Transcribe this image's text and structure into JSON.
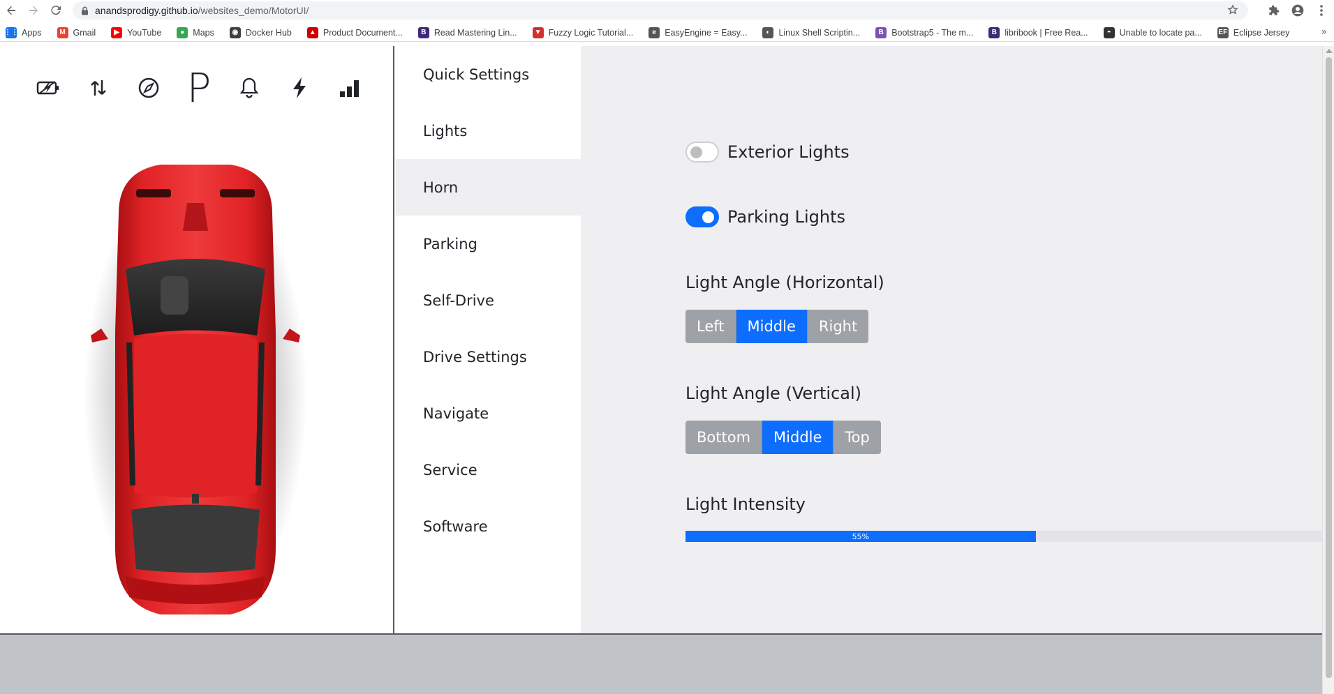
{
  "browser": {
    "url_host": "anandsprodigy.github.io",
    "url_path": "/websites_demo/MotorUI/",
    "bookmarks": [
      {
        "label": "Apps",
        "icon": "apps-grid-icon",
        "color": "#1a73e8"
      },
      {
        "label": "Gmail",
        "icon": "gmail-icon",
        "color": "#ea4335"
      },
      {
        "label": "YouTube",
        "icon": "youtube-icon",
        "color": "#ff0000"
      },
      {
        "label": "Maps",
        "icon": "maps-icon",
        "color": "#34a853"
      },
      {
        "label": "Docker Hub",
        "icon": "docker-icon",
        "color": "#3c4043"
      },
      {
        "label": "Product Document...",
        "icon": "redhat-icon",
        "color": "#cc0000"
      },
      {
        "label": "Read Mastering Lin...",
        "icon": "b-icon",
        "color": "#3d2a78"
      },
      {
        "label": "Fuzzy Logic Tutorial...",
        "icon": "v-icon",
        "color": "#d32f2f"
      },
      {
        "label": "EasyEngine = Easy...",
        "icon": "easyengine-icon",
        "color": "#555555"
      },
      {
        "label": "Linux Shell Scriptin...",
        "icon": "globe-icon",
        "color": "#555555"
      },
      {
        "label": "Bootstrap5 - The m...",
        "icon": "bootstrap-icon",
        "color": "#7952b3"
      },
      {
        "label": "libribook | Free Rea...",
        "icon": "b-icon",
        "color": "#3d2a78"
      },
      {
        "label": "Unable to locate pa...",
        "icon": "ubuntu-icon",
        "color": "#333333"
      },
      {
        "label": "Eclipse Jersey",
        "icon": "eclipse-icon",
        "color": "#555555"
      }
    ]
  },
  "status_bar": {
    "icons": [
      "battery-charging-icon",
      "up-down-arrows-icon",
      "compass-icon",
      "parking-icon",
      "bell-icon",
      "lightning-icon",
      "signal-bars-icon"
    ],
    "parking_letter": "P"
  },
  "menu": {
    "items": [
      "Quick Settings",
      "Lights",
      "Horn",
      "Parking",
      "Self-Drive",
      "Drive Settings",
      "Navigate",
      "Service",
      "Software"
    ],
    "active_index": 2
  },
  "lights": {
    "exterior_label": "Exterior Lights",
    "exterior_on": false,
    "parking_label": "Parking Lights",
    "parking_on": true,
    "horizontal_label": "Light Angle (Horizontal)",
    "horizontal_options": [
      "Left",
      "Middle",
      "Right"
    ],
    "horizontal_selected": "Middle",
    "vertical_label": "Light Angle (Vertical)",
    "vertical_options": [
      "Bottom",
      "Middle",
      "Top"
    ],
    "vertical_selected": "Middle",
    "intensity_label": "Light Intensity",
    "intensity_percent": 55,
    "intensity_text": "55%"
  },
  "colors": {
    "accent": "#0d6efd",
    "panel_bg": "#efeef1",
    "car_red": "#d6191c",
    "footer": "#c0c4c8"
  }
}
